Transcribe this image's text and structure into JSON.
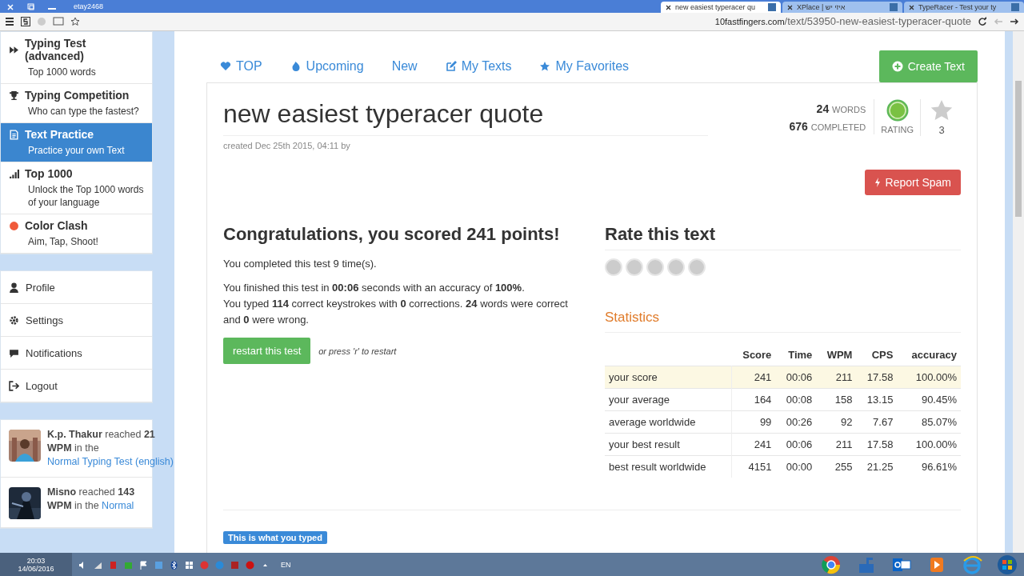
{
  "browser": {
    "user": "etay2468",
    "tabs": [
      {
        "title": "new easiest typeracer qu",
        "selected": true
      },
      {
        "title": "XPlace | איזי יש",
        "selected": false
      },
      {
        "title": "TypeRacer - Test your ty",
        "selected": false
      }
    ],
    "url": {
      "host": "10fastfingers.com",
      "path": "/text/53950-new-easiest-typeracer-quote"
    }
  },
  "sidebar": {
    "games": [
      {
        "title": "Typing Test (advanced)",
        "subtitle": "Top 1000 words",
        "selected": false
      },
      {
        "title": "Typing Competition",
        "subtitle": "Who can type the fastest?",
        "selected": false
      },
      {
        "title": "Text Practice",
        "subtitle": "Practice your own Text",
        "selected": true
      },
      {
        "title": "Top 1000",
        "subtitle": "Unlock the Top 1000 words of your language",
        "selected": false
      },
      {
        "title": "Color Clash",
        "subtitle": "Aim, Tap, Shoot!",
        "selected": false
      }
    ],
    "account": [
      "Profile",
      "Settings",
      "Notifications",
      "Logout"
    ],
    "feed": [
      {
        "text": "**K.p. Thakur** reached **21 WPM** in the",
        "link": "Normal Typing Test (english)"
      },
      {
        "text": "**Misno** reached **143 WPM** in the",
        "link": "Normal"
      }
    ]
  },
  "nav": {
    "tabs": [
      "TOP",
      "Upcoming",
      "New",
      "My Texts",
      "My Favorites"
    ],
    "create_button": "Create Text"
  },
  "text": {
    "title": "new easiest typeracer quote",
    "created": "created Dec 25th 2015, 04:11 by",
    "words": "24",
    "words_label": "WORDS",
    "completed": "676",
    "completed_label": "COMPLETED",
    "rating_label": "RATING",
    "favorites": "3",
    "report_button": "Report Spam"
  },
  "result": {
    "heading": "Congratulations, you scored 241 points!",
    "completed_times": "You completed this test 9 time(s).",
    "details": [
      "You finished this test in **00:06** seconds with an accuracy of **100%**.",
      "You typed **114** correct keystrokes with **0** corrections. **24** words were correct and **0** were wrong."
    ],
    "restart_button": "restart this test",
    "restart_hint": "or press 'r' to restart"
  },
  "rating": {
    "heading": "Rate this text",
    "stars": 0
  },
  "statistics": {
    "heading": "Statistics",
    "columns": [
      "Score",
      "Time",
      "WPM",
      "CPS",
      "accuracy"
    ],
    "rows": [
      {
        "label": "your score",
        "current": true,
        "cells": [
          "241",
          "00:06",
          "211",
          "17.58",
          "100.00%"
        ]
      },
      {
        "label": "your average",
        "current": false,
        "cells": [
          "164",
          "00:08",
          "158",
          "13.15",
          "90.45%"
        ]
      },
      {
        "label": "average worldwide",
        "current": false,
        "cells": [
          "99",
          "00:26",
          "92",
          "7.67",
          "85.07%"
        ]
      },
      {
        "label": "your best result",
        "current": false,
        "cells": [
          "241",
          "00:06",
          "211",
          "17.58",
          "100.00%"
        ]
      },
      {
        "label": "best result worldwide",
        "current": false,
        "cells": [
          "4151",
          "00:00",
          "255",
          "21.25",
          "96.61%"
        ]
      }
    ]
  },
  "typed_label": "This is what you typed",
  "taskbar": {
    "time": "20:03",
    "date": "14/06/2016",
    "language": "EN"
  }
}
